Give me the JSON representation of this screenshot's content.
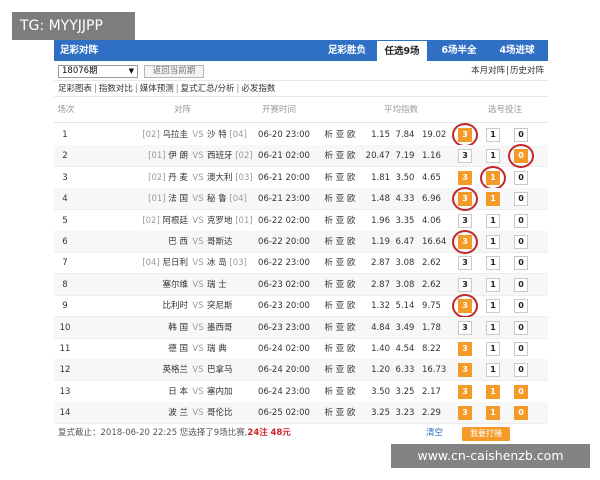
{
  "watermark_top": "TG: MYYJJPP",
  "watermark_bottom": "www.cn-caishenzb.com",
  "header": {
    "title": "足彩对阵",
    "tabs": [
      "足彩胜负",
      "任选9场",
      "6场半全",
      "4场进球"
    ],
    "active_tab": "任选9场"
  },
  "toolbar": {
    "issue_select": "18076期",
    "back_button": "返回当前期",
    "month_link": "本月对阵",
    "divider": "|",
    "history_link": "历史对阵"
  },
  "links": [
    "足彩图表",
    "指数对比",
    "媒体预测",
    "复式汇总/分析",
    "必发指数"
  ],
  "columns": [
    "场次",
    "对阵",
    "开赛时间",
    "",
    "平均指数",
    "选号投注"
  ],
  "vs_text": "VS",
  "analysis_text": "析 亚 欧",
  "accent_color": "#f39a28",
  "header_color": "#2f6fc4",
  "matches": [
    {
      "no": "1",
      "home_rank": "[02]",
      "home": "乌拉圭",
      "away": "沙 特",
      "away_rank": "[04]",
      "time": "06-20 23:00",
      "odds": [
        "1.15",
        "7.84",
        "19.02"
      ],
      "selected": [
        true,
        false,
        false
      ],
      "circled": [
        true,
        false,
        false
      ]
    },
    {
      "no": "2",
      "home_rank": "[01]",
      "home": "伊 朗",
      "away": "西班牙",
      "away_rank": "[02]",
      "time": "06-21 02:00",
      "odds": [
        "20.47",
        "7.19",
        "1.16"
      ],
      "selected": [
        false,
        false,
        true
      ],
      "circled": [
        false,
        false,
        true
      ]
    },
    {
      "no": "3",
      "home_rank": "[02]",
      "home": "丹 麦",
      "away": "澳大利",
      "away_rank": "[03]",
      "time": "06-21 20:00",
      "odds": [
        "1.81",
        "3.50",
        "4.65"
      ],
      "selected": [
        true,
        true,
        false
      ],
      "circled": [
        false,
        true,
        false
      ]
    },
    {
      "no": "4",
      "home_rank": "[01]",
      "home": "法 国",
      "away": "秘 鲁",
      "away_rank": "[04]",
      "time": "06-21 23:00",
      "odds": [
        "1.48",
        "4.33",
        "6.96"
      ],
      "selected": [
        true,
        true,
        false
      ],
      "circled": [
        true,
        false,
        false
      ]
    },
    {
      "no": "5",
      "home_rank": "[02]",
      "home": "阿根廷",
      "away": "克罗地",
      "away_rank": "[01]",
      "time": "06-22 02:00",
      "odds": [
        "1.96",
        "3.35",
        "4.06"
      ],
      "selected": [
        false,
        false,
        false
      ],
      "circled": [
        false,
        false,
        false
      ]
    },
    {
      "no": "6",
      "home_rank": "",
      "home": "巴 西",
      "away": "哥斯达",
      "away_rank": "",
      "time": "06-22 20:00",
      "odds": [
        "1.19",
        "6.47",
        "16.64"
      ],
      "selected": [
        true,
        false,
        false
      ],
      "circled": [
        true,
        false,
        false
      ]
    },
    {
      "no": "7",
      "home_rank": "[04]",
      "home": "尼日利",
      "away": "冰 岛",
      "away_rank": "[03]",
      "time": "06-22 23:00",
      "odds": [
        "2.87",
        "3.08",
        "2.62"
      ],
      "selected": [
        false,
        false,
        false
      ],
      "circled": [
        false,
        false,
        false
      ]
    },
    {
      "no": "8",
      "home_rank": "",
      "home": "塞尔维",
      "away": "瑞 士",
      "away_rank": "",
      "time": "06-23 02:00",
      "odds": [
        "2.87",
        "3.08",
        "2.62"
      ],
      "selected": [
        false,
        false,
        false
      ],
      "circled": [
        false,
        false,
        false
      ]
    },
    {
      "no": "9",
      "home_rank": "",
      "home": "比利时",
      "away": "突尼斯",
      "away_rank": "",
      "time": "06-23 20:00",
      "odds": [
        "1.32",
        "5.14",
        "9.75"
      ],
      "selected": [
        true,
        false,
        false
      ],
      "circled": [
        true,
        false,
        false
      ]
    },
    {
      "no": "10",
      "home_rank": "",
      "home": "韩 国",
      "away": "墨西哥",
      "away_rank": "",
      "time": "06-23 23:00",
      "odds": [
        "4.84",
        "3.49",
        "1.78"
      ],
      "selected": [
        false,
        false,
        false
      ],
      "circled": [
        false,
        false,
        false
      ]
    },
    {
      "no": "11",
      "home_rank": "",
      "home": "德 国",
      "away": "瑞 典",
      "away_rank": "",
      "time": "06-24 02:00",
      "odds": [
        "1.40",
        "4.54",
        "8.22"
      ],
      "selected": [
        true,
        false,
        false
      ],
      "circled": [
        false,
        false,
        false
      ]
    },
    {
      "no": "12",
      "home_rank": "",
      "home": "英格兰",
      "away": "巴拿马",
      "away_rank": "",
      "time": "06-24 20:00",
      "odds": [
        "1.20",
        "6.33",
        "16.73"
      ],
      "selected": [
        true,
        false,
        false
      ],
      "circled": [
        false,
        false,
        false
      ]
    },
    {
      "no": "13",
      "home_rank": "",
      "home": "日 本",
      "away": "塞内加",
      "away_rank": "",
      "time": "06-24 23:00",
      "odds": [
        "3.50",
        "3.25",
        "2.17"
      ],
      "selected": [
        true,
        true,
        true
      ],
      "circled": [
        false,
        false,
        false
      ]
    },
    {
      "no": "14",
      "home_rank": "",
      "home": "波 兰",
      "away": "哥伦比",
      "away_rank": "",
      "time": "06-25 02:00",
      "odds": [
        "3.25",
        "3.23",
        "2.29"
      ],
      "selected": [
        true,
        true,
        true
      ],
      "circled": [
        false,
        false,
        false
      ]
    }
  ],
  "option_labels": [
    "3",
    "1",
    "0"
  ],
  "footer": {
    "deadline": "复式截止：2018-06-20 22:25 您选择了9场比赛,",
    "bets": "24注",
    "amount": "48元",
    "clear": "清空",
    "buy": "我要打赌"
  }
}
